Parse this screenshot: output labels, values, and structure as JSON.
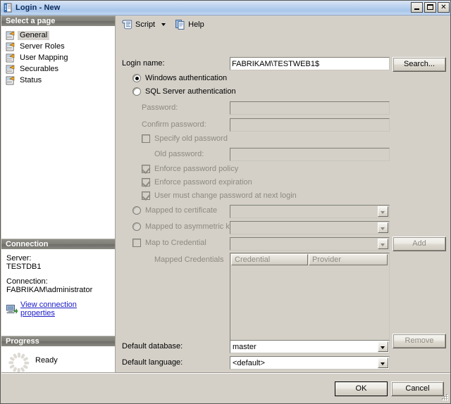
{
  "window": {
    "title": "Login - New",
    "icon": "login-page-icon",
    "controls": {
      "minimize": "Minimize",
      "maximize": "Maximize",
      "close": "Close"
    }
  },
  "sidebar": {
    "select_page_header": "Select a page",
    "pages": [
      {
        "label": "General",
        "selected": true
      },
      {
        "label": "Server Roles",
        "selected": false
      },
      {
        "label": "User Mapping",
        "selected": false
      },
      {
        "label": "Securables",
        "selected": false
      },
      {
        "label": "Status",
        "selected": false
      }
    ],
    "connection": {
      "header": "Connection",
      "server_label": "Server:",
      "server_value": "TESTDB1",
      "connection_label": "Connection:",
      "connection_value": "FABRIKAM\\administrator",
      "view_properties_link": "View connection properties"
    },
    "progress": {
      "header": "Progress",
      "status": "Ready"
    }
  },
  "toolbar": {
    "script_label": "Script",
    "script_icon": "script-icon",
    "dropdown_icon": "chevron-down-icon",
    "help_label": "Help",
    "help_icon": "help-icon"
  },
  "form": {
    "login_name_label": "Login name:",
    "login_name_value": "FABRIKAM\\TESTWEB1$",
    "login_name_placeholder": "",
    "search_button": "Search...",
    "windows_auth_label": "Windows authentication",
    "windows_auth_selected": true,
    "sql_auth_label": "SQL Server authentication",
    "sql_auth_selected": false,
    "password_label": "Password:",
    "password_value": "",
    "confirm_password_label": "Confirm password:",
    "confirm_password_value": "",
    "specify_old_password_label": "Specify old password",
    "specify_old_password_checked": false,
    "old_password_label": "Old password:",
    "old_password_value": "",
    "enforce_policy_label": "Enforce password policy",
    "enforce_policy_checked": true,
    "enforce_expiration_label": "Enforce password expiration",
    "enforce_expiration_checked": true,
    "must_change_label": "User must change password at next login",
    "must_change_checked": true,
    "mapped_cert_label": "Mapped to certificate",
    "mapped_cert_selected": false,
    "mapped_cert_value": "",
    "mapped_key_label": "Mapped to asymmetric key",
    "mapped_key_selected": false,
    "mapped_key_value": "",
    "map_credential_label": "Map to Credential",
    "map_credential_checked": false,
    "map_credential_value": "",
    "add_button": "Add",
    "mapped_credentials_label": "Mapped Credentials",
    "credentials_columns": [
      "Credential",
      "Provider"
    ],
    "credentials_rows": [],
    "remove_button": "Remove",
    "default_database_label": "Default database:",
    "default_database_value": "master",
    "default_language_label": "Default language:",
    "default_language_value": "<default>"
  },
  "footer": {
    "ok_button": "OK",
    "cancel_button": "Cancel"
  },
  "colors": {
    "dialog_face": "#d4d0c8",
    "title_gradient_top": "#d9e5f5",
    "title_text": "#0a2a5e",
    "panel_header": "#807f78",
    "link": "#1919c6",
    "disabled_text": "#8d8a82"
  }
}
